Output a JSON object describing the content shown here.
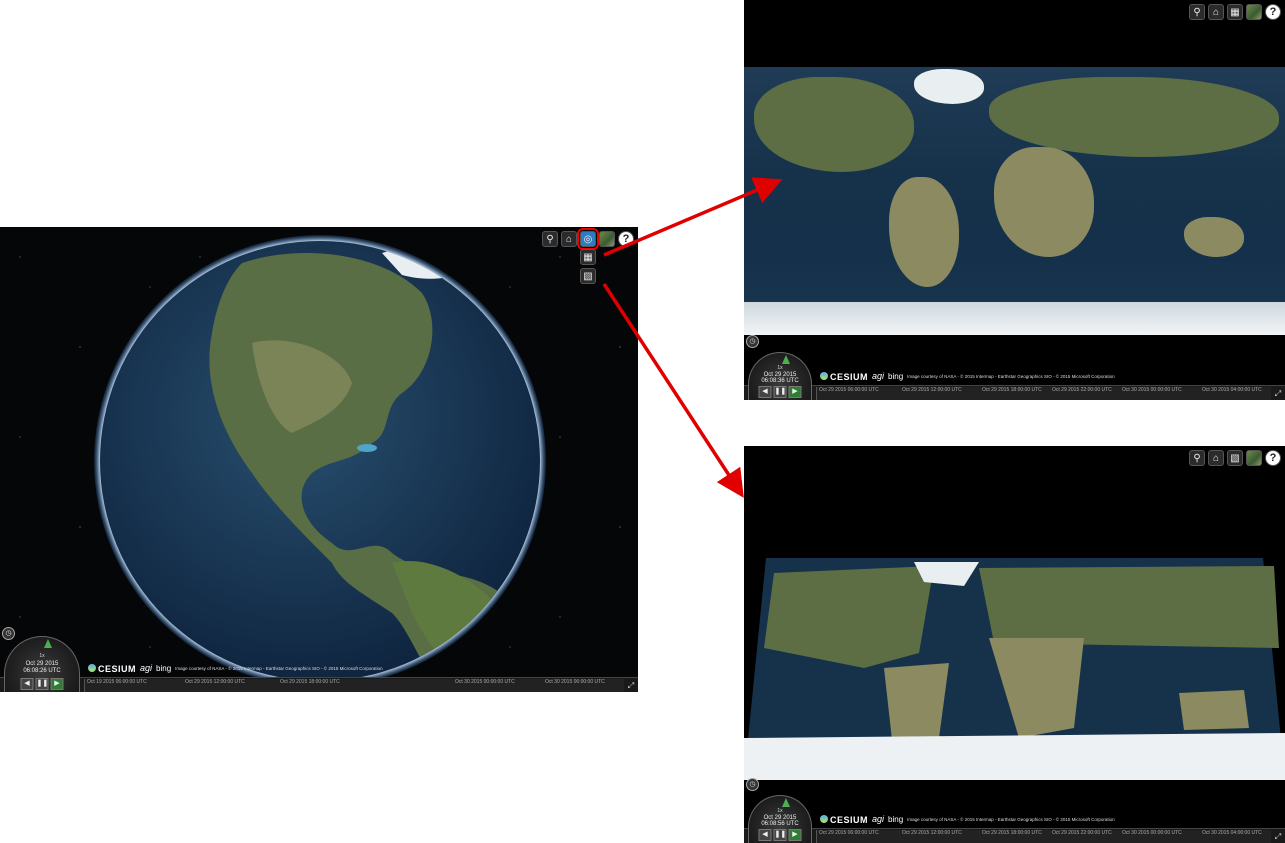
{
  "viewers": {
    "globe3d": {
      "toolbar": {
        "search": "search-icon",
        "home": "home-icon",
        "scene_mode": "globe-icon",
        "imagery": "imagery-icon",
        "help": "?"
      },
      "scene_modes": [
        "grid-2d-icon",
        "columbus-view-icon"
      ],
      "animation": {
        "speed": "1x",
        "date": "Oct 29 2015",
        "time": "06:08:26 UTC"
      },
      "credits": {
        "cesium": "CESIUM",
        "agi": "agi",
        "bing": "bing",
        "attribution": "Image courtesy of NASA - © 2015 Intermap - Earthstar Geographics SIO - © 2015 Microsoft Corporation"
      },
      "timeline_labels": [
        "Oct 19 2015 06:00:00 UTC",
        "Oct 29 2015 12:00:00 UTC",
        "Oct 29 2015 18:00:00 UTC",
        "Oct 30 2015 00:00:00 UTC",
        "Oct 30 2015 06:00:00 UTC"
      ]
    },
    "map2d": {
      "toolbar": {
        "search": "search-icon",
        "home": "home-icon",
        "scene_mode": "grid-2d-icon",
        "imagery": "imagery-icon",
        "help": "?"
      },
      "animation": {
        "speed": "1x",
        "date": "Oct 29 2015",
        "time": "06:08:36 UTC"
      },
      "credits": {
        "cesium": "CESIUM",
        "agi": "agi",
        "bing": "bing",
        "attribution": "Image courtesy of NASA - © 2015 Intermap - Earthstar Geographics SIO - © 2015 Microsoft Corporation"
      },
      "timeline_labels": [
        "Oct 29 2015 06:00:00 UTC",
        "Oct 29 2015 12:00:00 UTC",
        "Oct 29 2015 18:00:00 UTC",
        "Oct 29 2015 22:00:00 UTC",
        "Oct 30 2015 00:00:00 UTC",
        "Oct 30 2015 04:00:00 UTC"
      ]
    },
    "columbus": {
      "toolbar": {
        "search": "search-icon",
        "home": "home-icon",
        "scene_mode": "columbus-view-icon",
        "imagery": "imagery-icon",
        "help": "?"
      },
      "animation": {
        "speed": "1x",
        "date": "Oct 29 2015",
        "time": "06:08:56 UTC"
      },
      "credits": {
        "cesium": "CESIUM",
        "agi": "agi",
        "bing": "bing",
        "attribution": "Image courtesy of NASA - © 2015 Intermap - Earthstar Geographics SIO - © 2015 Microsoft Corporation"
      },
      "timeline_labels": [
        "Oct 29 2015 06:00:00 UTC",
        "Oct 29 2015 12:00:00 UTC",
        "Oct 29 2015 18:00:00 UTC",
        "Oct 29 2015 22:00:00 UTC",
        "Oct 30 2015 00:00:00 UTC",
        "Oct 30 2015 04:00:00 UTC"
      ]
    }
  },
  "colors": {
    "arrow": "#e00000",
    "highlight": "#e00000",
    "play": "#2e7d32",
    "ocean": "#16324b"
  }
}
